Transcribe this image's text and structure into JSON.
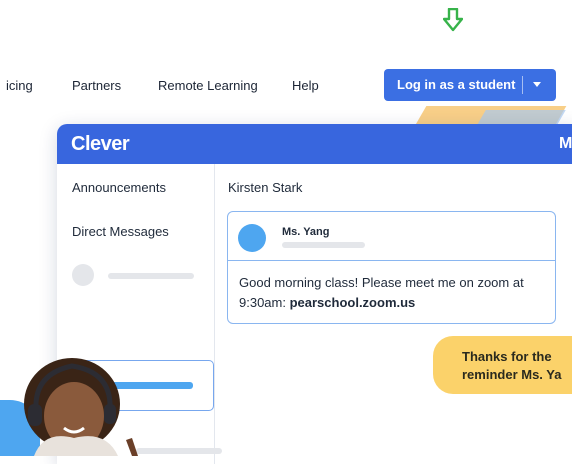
{
  "nav": {
    "items": [
      "icing",
      "Partners",
      "Remote Learning",
      "Help"
    ],
    "login_label": "Log in as a student"
  },
  "app": {
    "logo": "Clever",
    "header_right": "M",
    "sidebar": {
      "announcements": "Announcements",
      "direct_messages": "Direct Messages"
    },
    "chat": {
      "contact_name": "Kirsten Stark",
      "message": {
        "sender": "Ms. Yang",
        "text_before": "Good morning class! Please meet me on zoom at 9:30am: ",
        "link": "pearschool.zoom.us"
      },
      "reply": "Thanks for the reminder Ms. Ya"
    }
  },
  "icons": {
    "arrow": "arrow-down-icon",
    "caret": "caret-down-icon",
    "avatar": "avatar-icon"
  },
  "colors": {
    "primary": "#3866de",
    "accent_blue": "#4ea6f0",
    "bubble_yellow": "#fbd26a",
    "arrow_green": "#37b34a"
  }
}
